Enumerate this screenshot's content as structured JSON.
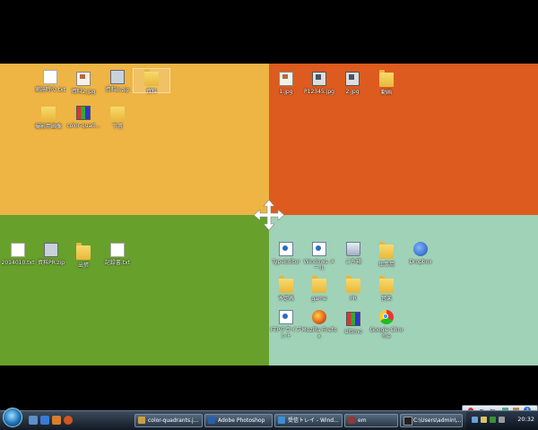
{
  "desktop": {
    "quadrants": {
      "top_left": {
        "color": "#eeb444",
        "icons": [
          {
            "label": "実施時の.txt",
            "type": "doc"
          },
          {
            "label": "資料2.jpg",
            "type": "img"
          },
          {
            "label": "資料B.zip",
            "type": "zip"
          },
          {
            "label": "資料",
            "type": "folder",
            "selected": true
          },
          {
            "label": "撮影用画像",
            "type": "folder"
          },
          {
            "label": "color-quad...",
            "type": "multi"
          },
          {
            "label": "下書",
            "type": "folder"
          }
        ]
      },
      "top_right": {
        "color": "#dd5b1e",
        "icons": [
          {
            "label": "1.jpg",
            "type": "img"
          },
          {
            "label": "P12345.jpg",
            "type": "film"
          },
          {
            "label": "2.jpg",
            "type": "film"
          },
          {
            "label": "動画",
            "type": "folder"
          }
        ]
      },
      "bottom_left": {
        "color": "#67a02a",
        "icons": [
          {
            "label": "2014010.txt",
            "type": "doc"
          },
          {
            "label": "資料PR.zip",
            "type": "zip"
          },
          {
            "label": "出張",
            "type": "folder"
          },
          {
            "label": "記録書.txt",
            "type": "doc"
          }
        ]
      },
      "bottom_right": {
        "color": "#9fd2b7",
        "icons": [
          {
            "label": "TypeEditor",
            "type": "app"
          },
          {
            "label": "Windows メール",
            "type": "app"
          },
          {
            "label": "ごみ箱",
            "type": "bin"
          },
          {
            "label": "仕事用",
            "type": "folder"
          },
          {
            "label": "Dropbox",
            "type": "globe"
          },
          {
            "label": "予定表",
            "type": "folder"
          },
          {
            "label": "game",
            "type": "folder"
          },
          {
            "label": "PR",
            "type": "folder"
          },
          {
            "label": "音楽",
            "type": "folder"
          },
          {
            "label": "FTPクライアント",
            "type": "app"
          },
          {
            "label": "Mozilla Firefox",
            "type": "fire"
          },
          {
            "label": "Ultimo",
            "type": "multi"
          },
          {
            "label": "Google Chrome",
            "type": "chrome"
          }
        ]
      }
    },
    "move_cursor_icon": "four-way-move-arrow-icon"
  },
  "taskbar": {
    "quick_launch": [
      "explorer-icon",
      "ie-icon",
      "media-icon",
      "firefox-icon"
    ],
    "tasks": [
      {
        "label": "color-quadrants.j...",
        "icon_color": "#c9a046"
      },
      {
        "label": "Adobe Photoshop",
        "icon_color": "#2a5fa8"
      },
      {
        "label": "受信トレイ - Wind...",
        "icon_color": "#3d8ed6"
      },
      {
        "label": "em",
        "icon_color": "#8a3b3b"
      },
      {
        "label": "C:\\Users\\admin\\...",
        "icon_color": "#222"
      }
    ],
    "clock": "20:32"
  },
  "language_bar": {
    "items": [
      "あ",
      "般",
      "?"
    ]
  }
}
